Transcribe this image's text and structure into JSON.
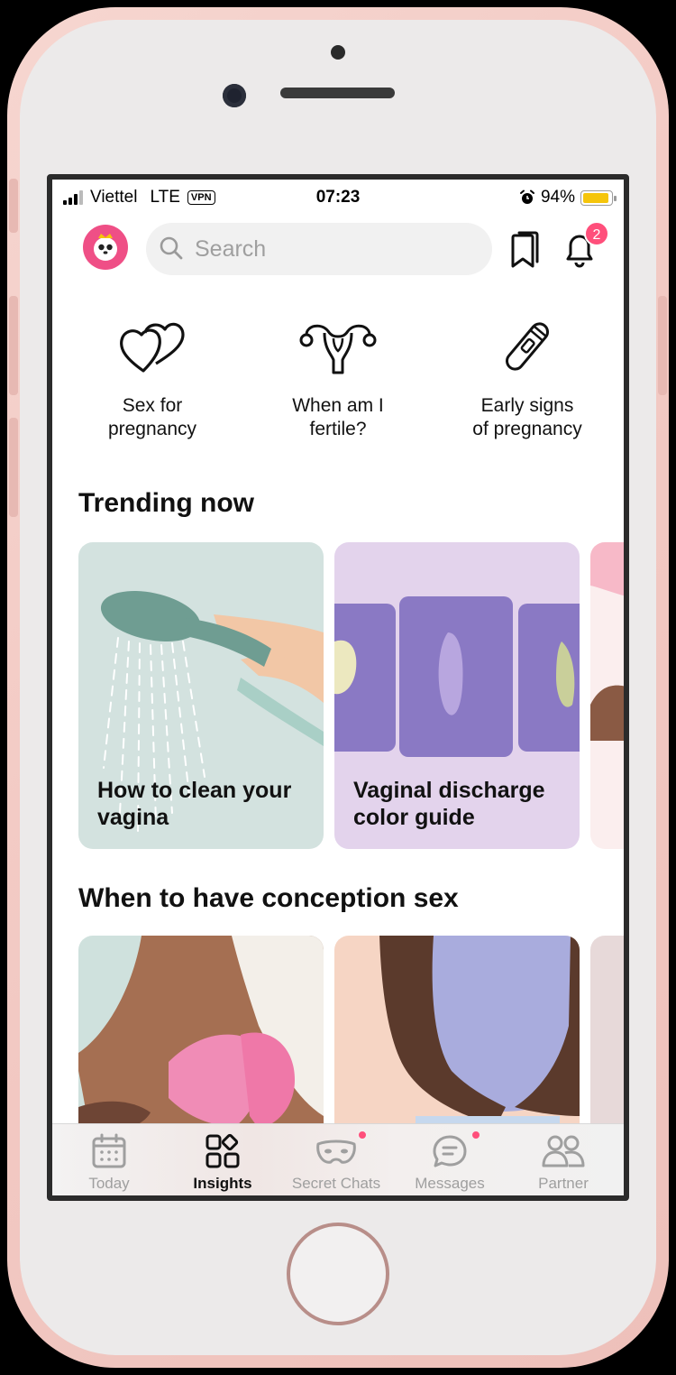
{
  "status_bar": {
    "carrier": "Viettel",
    "network": "LTE",
    "vpn": "VPN",
    "time": "07:23",
    "battery_percent": "94%",
    "battery_level": 0.94
  },
  "header": {
    "search_placeholder": "Search",
    "notification_count": "2"
  },
  "quick_links": [
    {
      "label": "Sex for\npregnancy",
      "icon": "hearts-icon"
    },
    {
      "label": "When am I\nfertile?",
      "icon": "uterus-icon"
    },
    {
      "label": "Early signs\nof pregnancy",
      "icon": "pregnancy-test-icon"
    }
  ],
  "sections": {
    "trending": {
      "title": "Trending now",
      "cards": [
        {
          "title": "How to clean your vagina"
        },
        {
          "title": "Vaginal discharge color guide"
        }
      ]
    },
    "conception": {
      "title": "When to have conception sex"
    }
  },
  "tabs": [
    {
      "label": "Today",
      "icon": "calendar-icon",
      "active": false
    },
    {
      "label": "Insights",
      "icon": "grid-icon",
      "active": true
    },
    {
      "label": "Secret Chats",
      "icon": "mask-icon",
      "active": false
    },
    {
      "label": "Messages",
      "icon": "chat-bubble-icon",
      "active": false
    },
    {
      "label": "Partner",
      "icon": "people-icon",
      "active": false
    }
  ],
  "colors": {
    "accent": "#ff4f7b",
    "avatar_bg": "#ef4f86",
    "card_trending_1": "#d3e2df",
    "card_trending_2": "#e3d3ec"
  }
}
